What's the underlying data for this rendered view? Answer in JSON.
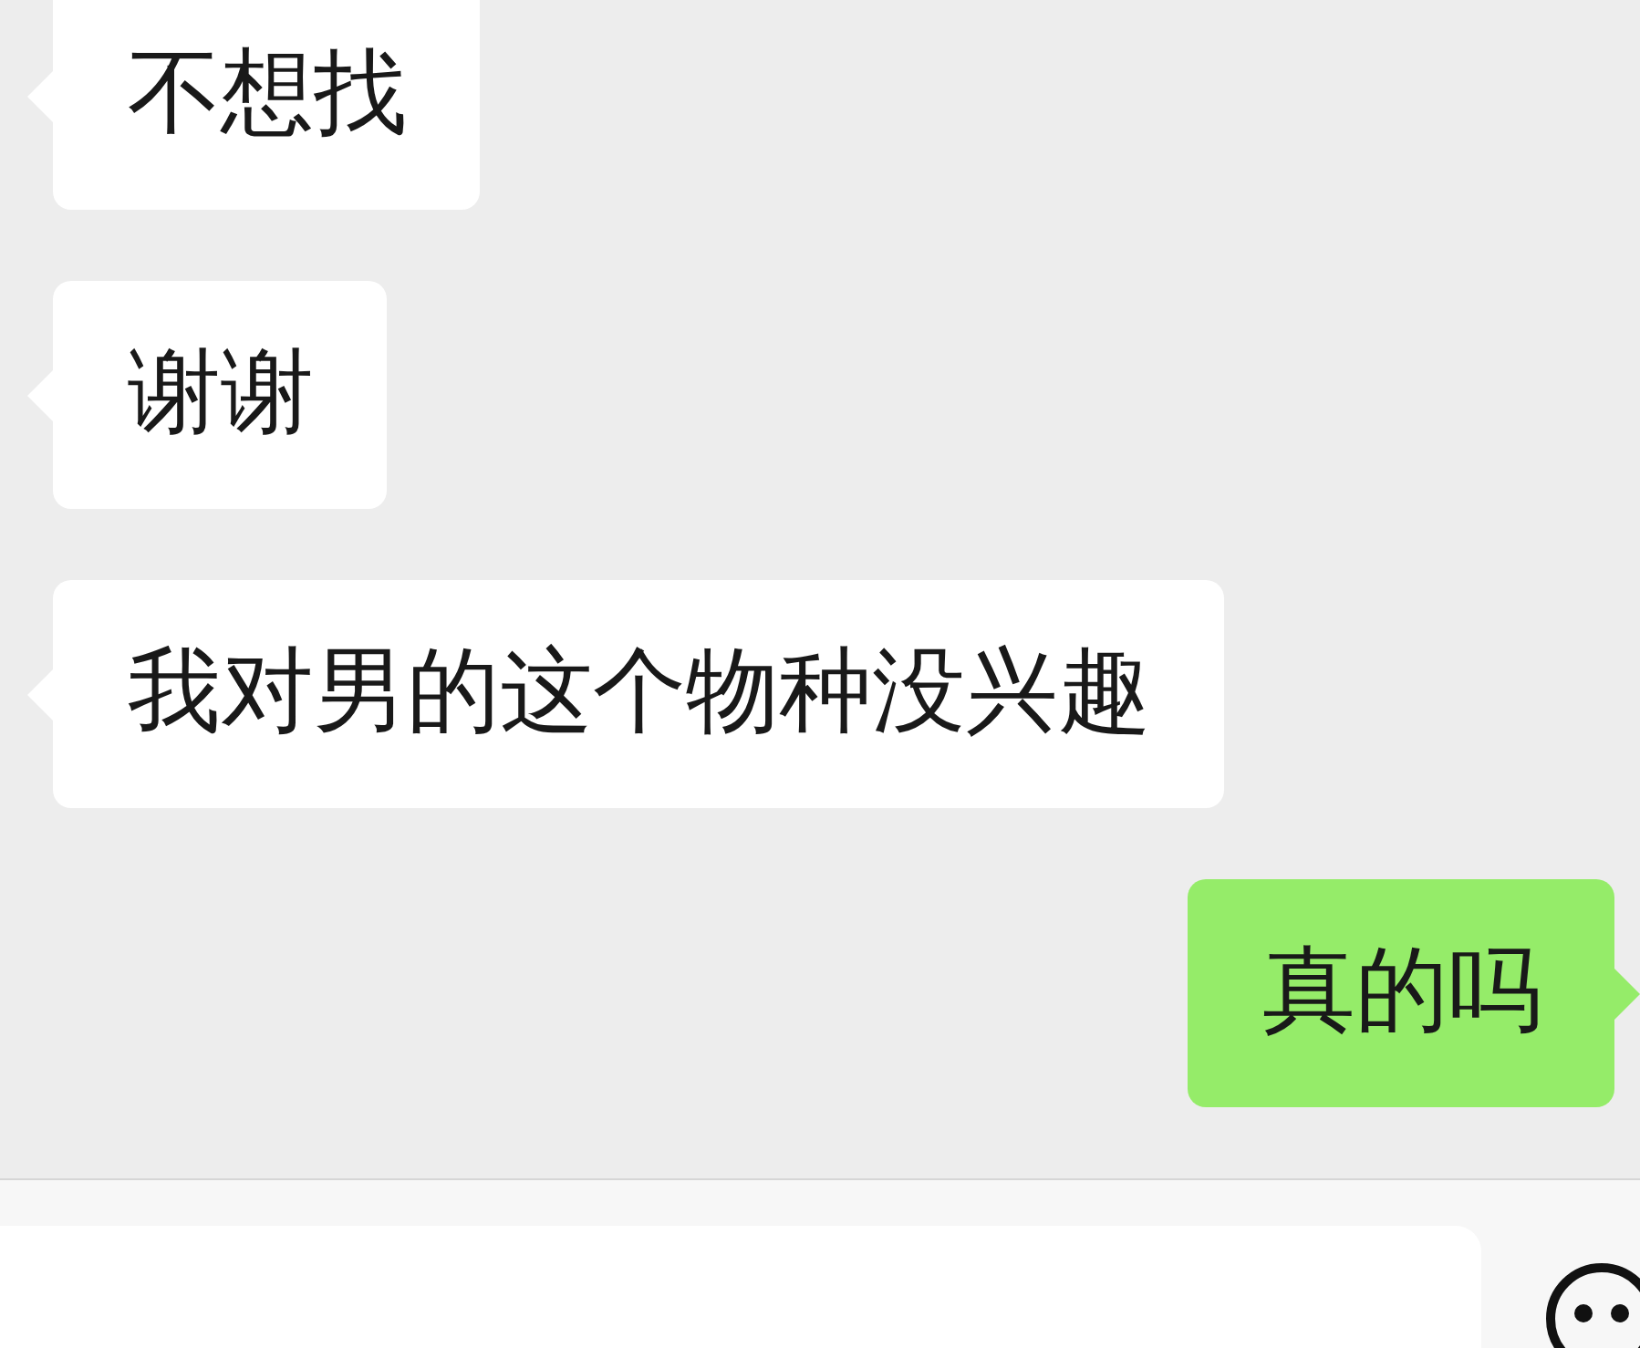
{
  "messages": [
    {
      "kind": "received",
      "text": "不想找"
    },
    {
      "kind": "received",
      "text": "谢谢"
    },
    {
      "kind": "received",
      "text": "我对男的这个物种没兴趣"
    },
    {
      "kind": "sent",
      "text": "真的吗"
    }
  ],
  "input_bar": {
    "field": {
      "kind": "text"
    }
  }
}
